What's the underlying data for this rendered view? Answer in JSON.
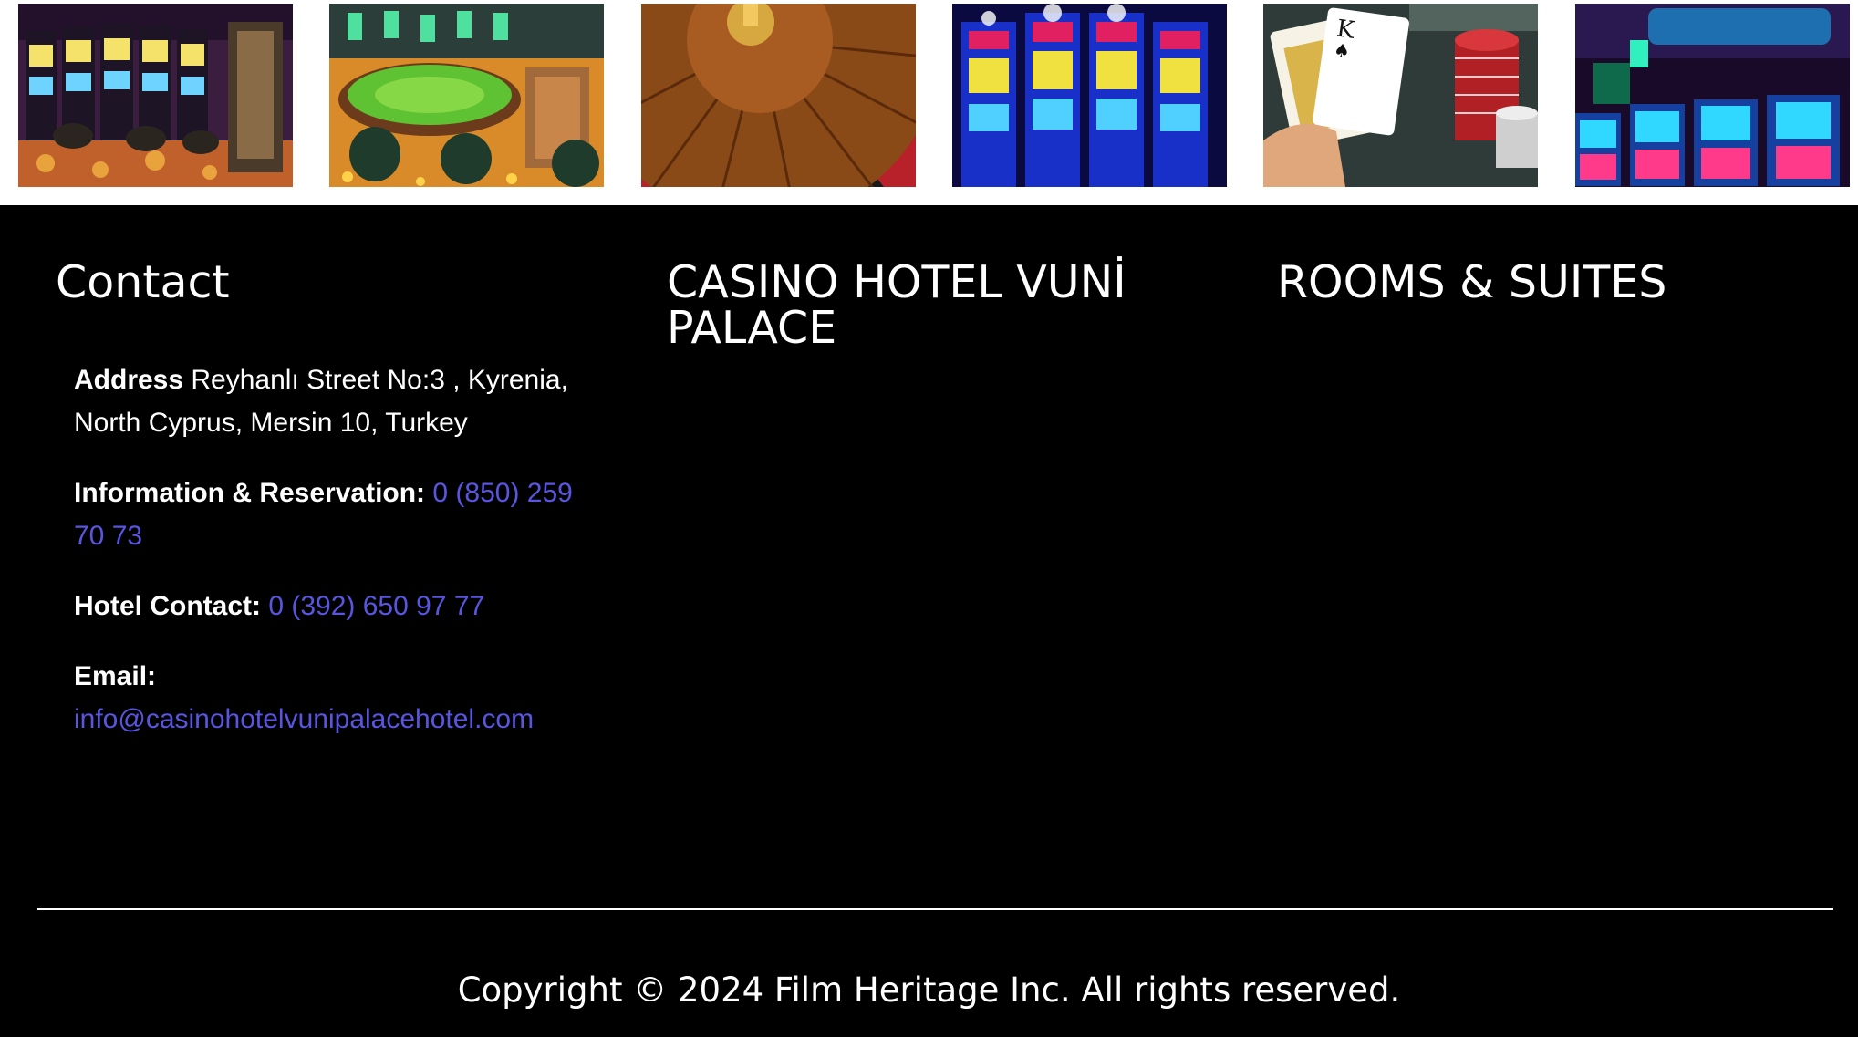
{
  "gallery": [
    {
      "name": "slot-machines-hall-photo"
    },
    {
      "name": "gaming-tables-photo"
    },
    {
      "name": "roulette-wheel-photo"
    },
    {
      "name": "neon-slot-machines-photo"
    },
    {
      "name": "cards-and-chips-photo"
    },
    {
      "name": "slot-machine-screens-photo"
    }
  ],
  "footer": {
    "contact": {
      "heading": "Contact",
      "address_label": "Address",
      "address_value": "Reyhanlı Street No:3 , Kyrenia, North Cyprus, Mersin 10, Turkey",
      "info_label": "Information & Reservation:",
      "info_phone": "0 (850) 259 70 73",
      "hotel_label": "Hotel Contact:",
      "hotel_phone": "0 (392) 650 97 77",
      "email_label": "Email:",
      "email_value": "info@casinohotelvunipalacehotel.com"
    },
    "hotel_heading": "CASINO HOTEL VUNİ PALACE",
    "rooms_heading": "ROOMS & SUITES",
    "copyright": "Copyright © 2024 Film Heritage Inc. All rights reserved."
  },
  "colors": {
    "background": "#000000",
    "strip_background": "#ffffff",
    "text": "#ffffff",
    "link": "#5a55e0"
  }
}
